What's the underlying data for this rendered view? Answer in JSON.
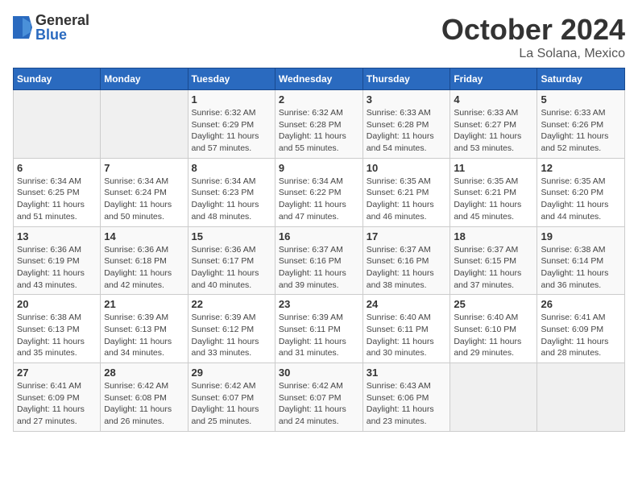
{
  "header": {
    "logo": {
      "general": "General",
      "blue": "Blue"
    },
    "title": "October 2024",
    "subtitle": "La Solana, Mexico"
  },
  "weekdays": [
    "Sunday",
    "Monday",
    "Tuesday",
    "Wednesday",
    "Thursday",
    "Friday",
    "Saturday"
  ],
  "weeks": [
    [
      null,
      null,
      {
        "day": 1,
        "sunrise": "6:32 AM",
        "sunset": "6:29 PM",
        "daylight": "11 hours and 57 minutes."
      },
      {
        "day": 2,
        "sunrise": "6:32 AM",
        "sunset": "6:28 PM",
        "daylight": "11 hours and 55 minutes."
      },
      {
        "day": 3,
        "sunrise": "6:33 AM",
        "sunset": "6:28 PM",
        "daylight": "11 hours and 54 minutes."
      },
      {
        "day": 4,
        "sunrise": "6:33 AM",
        "sunset": "6:27 PM",
        "daylight": "11 hours and 53 minutes."
      },
      {
        "day": 5,
        "sunrise": "6:33 AM",
        "sunset": "6:26 PM",
        "daylight": "11 hours and 52 minutes."
      }
    ],
    [
      {
        "day": 6,
        "sunrise": "6:34 AM",
        "sunset": "6:25 PM",
        "daylight": "11 hours and 51 minutes."
      },
      {
        "day": 7,
        "sunrise": "6:34 AM",
        "sunset": "6:24 PM",
        "daylight": "11 hours and 50 minutes."
      },
      {
        "day": 8,
        "sunrise": "6:34 AM",
        "sunset": "6:23 PM",
        "daylight": "11 hours and 48 minutes."
      },
      {
        "day": 9,
        "sunrise": "6:34 AM",
        "sunset": "6:22 PM",
        "daylight": "11 hours and 47 minutes."
      },
      {
        "day": 10,
        "sunrise": "6:35 AM",
        "sunset": "6:21 PM",
        "daylight": "11 hours and 46 minutes."
      },
      {
        "day": 11,
        "sunrise": "6:35 AM",
        "sunset": "6:21 PM",
        "daylight": "11 hours and 45 minutes."
      },
      {
        "day": 12,
        "sunrise": "6:35 AM",
        "sunset": "6:20 PM",
        "daylight": "11 hours and 44 minutes."
      }
    ],
    [
      {
        "day": 13,
        "sunrise": "6:36 AM",
        "sunset": "6:19 PM",
        "daylight": "11 hours and 43 minutes."
      },
      {
        "day": 14,
        "sunrise": "6:36 AM",
        "sunset": "6:18 PM",
        "daylight": "11 hours and 42 minutes."
      },
      {
        "day": 15,
        "sunrise": "6:36 AM",
        "sunset": "6:17 PM",
        "daylight": "11 hours and 40 minutes."
      },
      {
        "day": 16,
        "sunrise": "6:37 AM",
        "sunset": "6:16 PM",
        "daylight": "11 hours and 39 minutes."
      },
      {
        "day": 17,
        "sunrise": "6:37 AM",
        "sunset": "6:16 PM",
        "daylight": "11 hours and 38 minutes."
      },
      {
        "day": 18,
        "sunrise": "6:37 AM",
        "sunset": "6:15 PM",
        "daylight": "11 hours and 37 minutes."
      },
      {
        "day": 19,
        "sunrise": "6:38 AM",
        "sunset": "6:14 PM",
        "daylight": "11 hours and 36 minutes."
      }
    ],
    [
      {
        "day": 20,
        "sunrise": "6:38 AM",
        "sunset": "6:13 PM",
        "daylight": "11 hours and 35 minutes."
      },
      {
        "day": 21,
        "sunrise": "6:39 AM",
        "sunset": "6:13 PM",
        "daylight": "11 hours and 34 minutes."
      },
      {
        "day": 22,
        "sunrise": "6:39 AM",
        "sunset": "6:12 PM",
        "daylight": "11 hours and 33 minutes."
      },
      {
        "day": 23,
        "sunrise": "6:39 AM",
        "sunset": "6:11 PM",
        "daylight": "11 hours and 31 minutes."
      },
      {
        "day": 24,
        "sunrise": "6:40 AM",
        "sunset": "6:11 PM",
        "daylight": "11 hours and 30 minutes."
      },
      {
        "day": 25,
        "sunrise": "6:40 AM",
        "sunset": "6:10 PM",
        "daylight": "11 hours and 29 minutes."
      },
      {
        "day": 26,
        "sunrise": "6:41 AM",
        "sunset": "6:09 PM",
        "daylight": "11 hours and 28 minutes."
      }
    ],
    [
      {
        "day": 27,
        "sunrise": "6:41 AM",
        "sunset": "6:09 PM",
        "daylight": "11 hours and 27 minutes."
      },
      {
        "day": 28,
        "sunrise": "6:42 AM",
        "sunset": "6:08 PM",
        "daylight": "11 hours and 26 minutes."
      },
      {
        "day": 29,
        "sunrise": "6:42 AM",
        "sunset": "6:07 PM",
        "daylight": "11 hours and 25 minutes."
      },
      {
        "day": 30,
        "sunrise": "6:42 AM",
        "sunset": "6:07 PM",
        "daylight": "11 hours and 24 minutes."
      },
      {
        "day": 31,
        "sunrise": "6:43 AM",
        "sunset": "6:06 PM",
        "daylight": "11 hours and 23 minutes."
      },
      null,
      null
    ]
  ]
}
